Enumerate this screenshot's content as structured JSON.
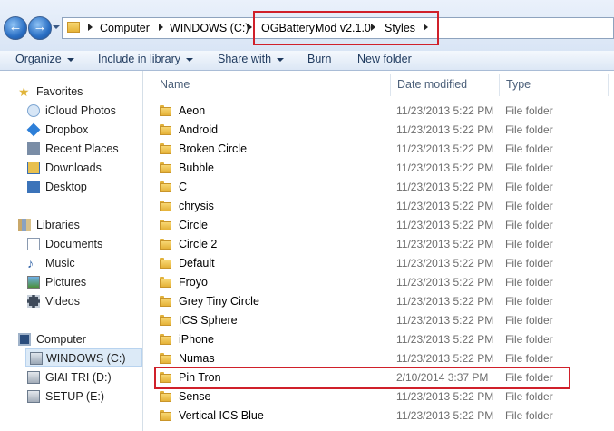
{
  "address_bar": {
    "crumbs": [
      "Computer",
      "WINDOWS (C:)",
      "OGBatteryMod v2.1.0",
      "Styles"
    ]
  },
  "toolbar": {
    "organize": "Organize",
    "include_in_library": "Include in library",
    "share_with": "Share with",
    "burn": "Burn",
    "new_folder": "New folder"
  },
  "nav": {
    "favorites": "Favorites",
    "icloud": "iCloud Photos",
    "dropbox": "Dropbox",
    "recent": "Recent Places",
    "downloads": "Downloads",
    "desktop": "Desktop",
    "libraries": "Libraries",
    "documents": "Documents",
    "music": "Music",
    "pictures": "Pictures",
    "videos": "Videos",
    "computer": "Computer",
    "drive_c": "WINDOWS (C:)",
    "drive_d": "GIAI TRI (D:)",
    "drive_e": "SETUP (E:)"
  },
  "columns": {
    "name": "Name",
    "date": "Date modified",
    "type": "Type"
  },
  "files": [
    {
      "name": "Aeon",
      "date": "11/23/2013 5:22 PM",
      "type": "File folder"
    },
    {
      "name": "Android",
      "date": "11/23/2013 5:22 PM",
      "type": "File folder"
    },
    {
      "name": "Broken Circle",
      "date": "11/23/2013 5:22 PM",
      "type": "File folder"
    },
    {
      "name": "Bubble",
      "date": "11/23/2013 5:22 PM",
      "type": "File folder"
    },
    {
      "name": "C",
      "date": "11/23/2013 5:22 PM",
      "type": "File folder"
    },
    {
      "name": "chrysis",
      "date": "11/23/2013 5:22 PM",
      "type": "File folder"
    },
    {
      "name": "Circle",
      "date": "11/23/2013 5:22 PM",
      "type": "File folder"
    },
    {
      "name": "Circle 2",
      "date": "11/23/2013 5:22 PM",
      "type": "File folder"
    },
    {
      "name": "Default",
      "date": "11/23/2013 5:22 PM",
      "type": "File folder"
    },
    {
      "name": "Froyo",
      "date": "11/23/2013 5:22 PM",
      "type": "File folder"
    },
    {
      "name": "Grey Tiny Circle",
      "date": "11/23/2013 5:22 PM",
      "type": "File folder"
    },
    {
      "name": "ICS Sphere",
      "date": "11/23/2013 5:22 PM",
      "type": "File folder"
    },
    {
      "name": "iPhone",
      "date": "11/23/2013 5:22 PM",
      "type": "File folder"
    },
    {
      "name": "Numas",
      "date": "11/23/2013 5:22 PM",
      "type": "File folder"
    },
    {
      "name": "Pin Tron",
      "date": "2/10/2014 3:37 PM",
      "type": "File folder"
    },
    {
      "name": "Sense",
      "date": "11/23/2013 5:22 PM",
      "type": "File folder"
    },
    {
      "name": "Vertical ICS Blue",
      "date": "11/23/2013 5:22 PM",
      "type": "File folder"
    }
  ]
}
